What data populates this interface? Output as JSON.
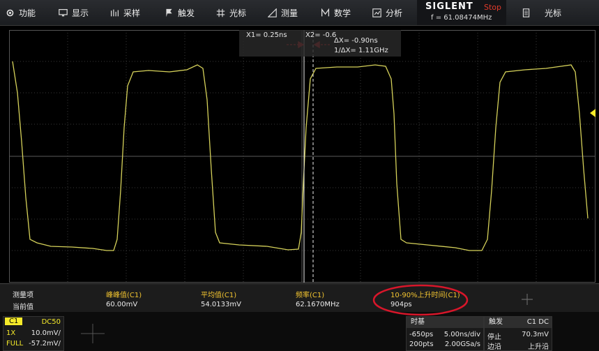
{
  "menu": [
    {
      "icon": "gear-icon",
      "label": "功能"
    },
    {
      "icon": "display-icon",
      "label": "显示"
    },
    {
      "icon": "acquire-icon",
      "label": "采样"
    },
    {
      "icon": "trigger-icon",
      "label": "触发"
    },
    {
      "icon": "cursor-icon",
      "label": "光标"
    },
    {
      "icon": "measure-icon",
      "label": "测量"
    },
    {
      "icon": "math-icon",
      "label": "数学"
    },
    {
      "icon": "analysis-icon",
      "label": "分析"
    }
  ],
  "brand": {
    "logo": "SIGLENT",
    "status": "Stop",
    "freq": "f = 61.08474MHz"
  },
  "right_menu": {
    "icon": "cursor-list-icon",
    "label": "光标"
  },
  "cursor": {
    "x1": "X1= 0.25ns",
    "x2": "X2= -0.6",
    "dx": "ΔX= -0.90ns",
    "inv_dx": "1/ΔX= 1.11GHz"
  },
  "channel_marker": "C1",
  "measure": {
    "row1_label": "测量项",
    "row2_label": "当前值",
    "items": [
      {
        "name": "峰峰值(C1)",
        "value": "60.00mV"
      },
      {
        "name": "平均值(C1)",
        "value": "54.0133mV"
      },
      {
        "name": "频率(C1)",
        "value": "62.1670MHz"
      },
      {
        "name": "10-90%上升时间(C1)",
        "value": "904ps"
      }
    ],
    "add_icon": "add-icon"
  },
  "channel": {
    "tag": "C1",
    "coupling": "DC50",
    "probe": "1X",
    "scale": "10.0mV/",
    "bw": "FULL",
    "offset": "-57.2mV/"
  },
  "timebase": {
    "title": "时基",
    "delay": "-650ps",
    "scale": "5.00ns/div",
    "points": "200pts",
    "rate": "2.00GSa/s"
  },
  "trigger": {
    "title": "触发",
    "src": "C1 DC",
    "mode": "停止",
    "level": "70.3mV",
    "type": "边沿",
    "slope": "上升沿"
  },
  "colors": {
    "trace": "#d6d25a",
    "accent": "#f2c430",
    "stop": "#e03a2a",
    "annotation": "#d8162a"
  }
}
